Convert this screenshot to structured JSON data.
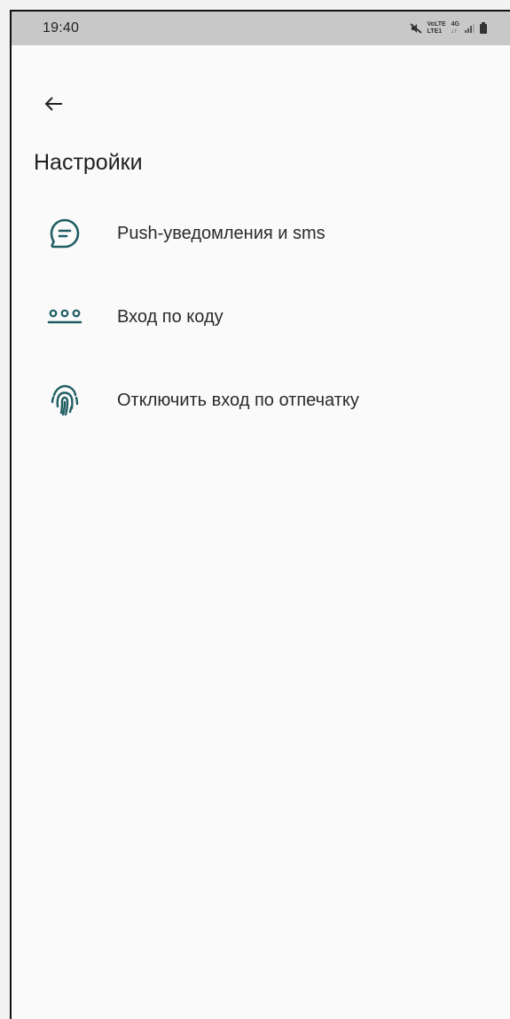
{
  "status_bar": {
    "time": "19:40",
    "network_top": "VoLTE",
    "network_mid": "4G",
    "network_label": "LTE1"
  },
  "header": {
    "back_icon": "arrow-left-icon",
    "title": "Настройки"
  },
  "menu": {
    "items": [
      {
        "label": "Push-уведомления и sms",
        "icon": "chat-bubble-icon"
      },
      {
        "label": "Вход по коду",
        "icon": "pin-code-icon"
      },
      {
        "label": "Отключить вход по отпечатку",
        "icon": "fingerprint-icon"
      }
    ]
  },
  "colors": {
    "accent": "#1f5d63",
    "status_bar": "#c8c8c8",
    "background": "#fafafa"
  }
}
